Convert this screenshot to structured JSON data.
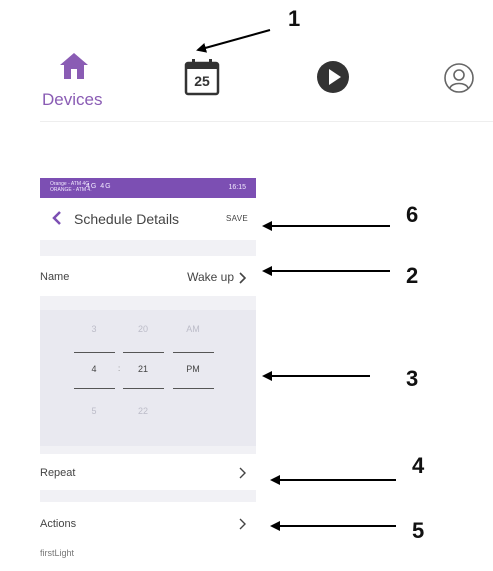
{
  "nav": {
    "devices_label": "Devices",
    "calendar_day": "25",
    "icons": [
      "home-icon",
      "calendar-icon",
      "play-icon",
      "user-icon"
    ],
    "accent": "#8a5cb4"
  },
  "annotations": [
    "1",
    "6",
    "2",
    "3",
    "4",
    "5"
  ],
  "status_bar": {
    "carrier": "Orange - ATM 4G\nORANGE - ATM 4.",
    "signal": "4G 4G",
    "right": "16:15",
    "color": "#7c4fb3"
  },
  "header": {
    "title": "Schedule Details",
    "save_label": "SAVE"
  },
  "name_row": {
    "label": "Name",
    "value": "Wake up"
  },
  "time_picker": {
    "hours": [
      "3",
      "4",
      "5"
    ],
    "minutes": [
      "20",
      "21",
      "22"
    ],
    "ampm": [
      "AM",
      "PM"
    ],
    "separator": ":"
  },
  "repeat_row": {
    "label": "Repeat"
  },
  "actions_row": {
    "label": "Actions",
    "sub": "firstLight"
  }
}
